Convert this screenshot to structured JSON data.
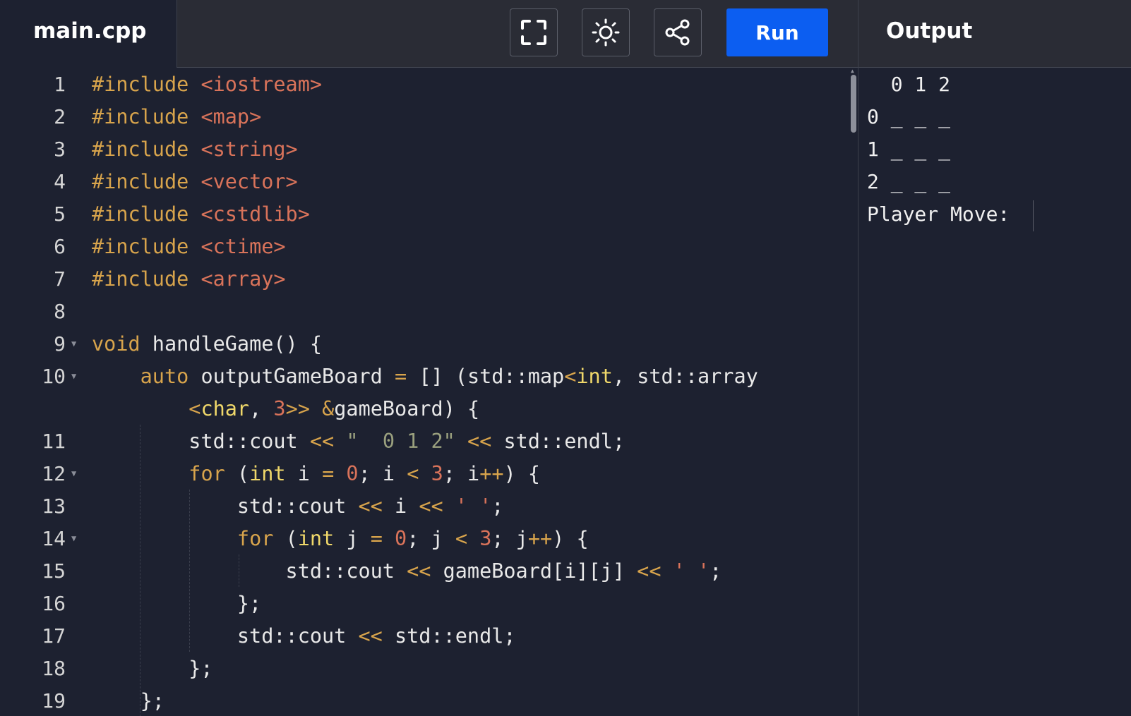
{
  "file_tab": {
    "name": "main.cpp"
  },
  "toolbar": {
    "fullscreen_icon": "fullscreen-icon",
    "theme_icon": "sun-icon",
    "share_icon": "share-icon",
    "run_label": "Run"
  },
  "output": {
    "title": "Output",
    "lines": [
      "  0 1 2",
      "0 _ _ _",
      "1 _ _ _",
      "2 _ _ _",
      "Player Move: "
    ]
  },
  "editor": {
    "line_numbers": [
      "1",
      "2",
      "3",
      "4",
      "5",
      "6",
      "7",
      "8",
      "9",
      "10",
      "",
      "11",
      "12",
      "13",
      "14",
      "15",
      "16",
      "17",
      "18",
      "19"
    ],
    "code_lines": [
      "#include <iostream>",
      "#include <map>",
      "#include <string>",
      "#include <vector>",
      "#include <cstdlib>",
      "#include <ctime>",
      "#include <array>",
      "",
      "void handleGame() {",
      "    auto outputGameBoard = [] (std::map<int, std::array",
      "        <char, 3>> &gameBoard) {",
      "        std::cout << \"  0 1 2\" << std::endl;",
      "        for (int i = 0; i < 3; i++) {",
      "            std::cout << i << ' ';",
      "            for (int j = 0; j < 3; j++) {",
      "                std::cout << gameBoard[i][j] << ' ';",
      "            };",
      "            std::cout << std::endl;",
      "        };",
      "    };"
    ],
    "foldable_lines": [
      "9",
      "10",
      "12",
      "14"
    ]
  }
}
